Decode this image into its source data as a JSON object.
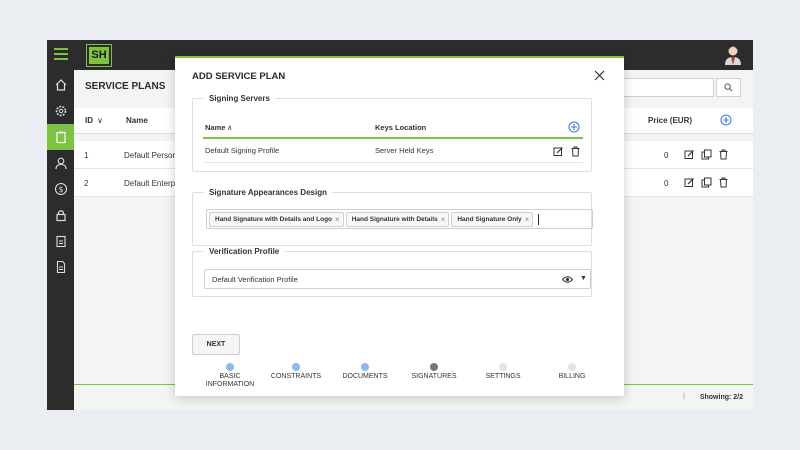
{
  "app": {
    "logo_text": "SH"
  },
  "page": {
    "title": "SERVICE PLANS",
    "columns": {
      "id": "ID",
      "name": "Name",
      "price": "Price (EUR)"
    },
    "rows": [
      {
        "id": "1",
        "name": "Default Person",
        "price": "0"
      },
      {
        "id": "2",
        "name": "Default Enterp",
        "price": "0"
      }
    ],
    "showing": "Showing: 2/2",
    "footer_sep": "|"
  },
  "modal": {
    "title": "ADD SERVICE PLAN",
    "servers": {
      "legend": "Signing Servers",
      "col_name": "Name",
      "col_keys": "Keys Location",
      "rows": [
        {
          "name": "Default Signing Profile",
          "keys": "Server Held Keys"
        }
      ]
    },
    "appearances": {
      "legend": "Signature Appearances Design",
      "chips": [
        "Hand Signature with Details and Logo",
        "Hand Signature with Details",
        "Hand Signature Only"
      ]
    },
    "verification": {
      "legend": "Verification Profile",
      "value": "Default Verification Profile"
    },
    "next_label": "NEXT",
    "steps": [
      {
        "label": "BASIC INFORMATION",
        "state": "done"
      },
      {
        "label": "CONSTRAINTS",
        "state": "done"
      },
      {
        "label": "DOCUMENTS",
        "state": "done"
      },
      {
        "label": "SIGNATURES",
        "state": "current"
      },
      {
        "label": "SETTINGS",
        "state": "todo"
      },
      {
        "label": "BILLING",
        "state": "todo"
      }
    ]
  },
  "colors": {
    "accent": "#7dc242",
    "sidebar": "#2c2c2c",
    "step_done": "#8fb7f0",
    "link_blue": "#3a7be0"
  }
}
